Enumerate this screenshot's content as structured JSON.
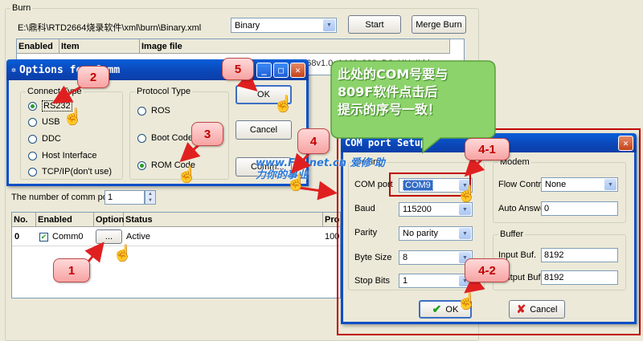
{
  "burn_group": {
    "title": "Burn",
    "path": "E:\\鼎科\\RTD2664烧录软件\\xml\\burn\\Binary.xml",
    "mode_select": "Binary",
    "start_label": "Start",
    "merge_label": "Merge Burn",
    "table_headers": [
      "Enabled",
      "Item",
      "Image file"
    ],
    "image_file_fragment": "2668v1.0_1440x900_D6_HH_II.bin"
  },
  "options_dialog": {
    "title": "Options for Comm",
    "connect_type": {
      "label": "Connect Type",
      "options": [
        "RS232",
        "USB",
        "DDC",
        "Host Interface",
        "TCP/IP(don't use)"
      ],
      "selected": "RS232"
    },
    "protocol_type": {
      "label": "Protocol Type",
      "options": [
        "ROS",
        "Boot Code",
        "ROM Code"
      ],
      "selected": "ROM Code"
    },
    "ok_label": "OK",
    "cancel_label": "Cancel",
    "comm_label": "Comm..."
  },
  "comm_ports": {
    "count_label": "The number of comm port",
    "count_value": "1",
    "headers": [
      "No.",
      "Enabled",
      "Option",
      "Status",
      "Pro"
    ],
    "rows": [
      {
        "no": "0",
        "enabled": "Comm0",
        "option": "...",
        "status": "Active",
        "progress": "100"
      }
    ]
  },
  "com_setup": {
    "title": "COM port Setup",
    "setting_label": "Setting",
    "com_port_label": "COM port",
    "com_port_value": "COM9",
    "baud_label": "Baud",
    "baud_value": "115200",
    "parity_label": "Parity",
    "parity_value": "No parity",
    "byte_size_label": "Byte Size",
    "byte_size_value": "8",
    "stop_bits_label": "Stop Bits",
    "stop_bits_value": "1",
    "modem_label": "Modem",
    "flow_control_label": "Flow Control",
    "flow_control_value": "None",
    "auto_answer_label": "Auto Answer",
    "auto_answer_value": "0",
    "buffer_label": "Buffer",
    "input_buf_label": "Input Buf.",
    "input_buf_value": "8192",
    "output_buf_label": "Output Buf.",
    "output_buf_value": "8192",
    "ok_label": "OK",
    "cancel_label": "Cancel"
  },
  "callout": {
    "line1": "此处的COM号要与",
    "line2": "809F软件点击后",
    "line3": "提示的序号一致！"
  },
  "watermark": "www.Fix.net.cn 爱修 助力你的事业",
  "badges": [
    "1",
    "2",
    "3",
    "4",
    "5",
    "4-1",
    "4-2"
  ],
  "colors": {
    "title_blue": "#0b4fc8",
    "highlight_red": "#c00000",
    "callout_green": "#8bd36a",
    "selection_blue": "#316ac5"
  }
}
